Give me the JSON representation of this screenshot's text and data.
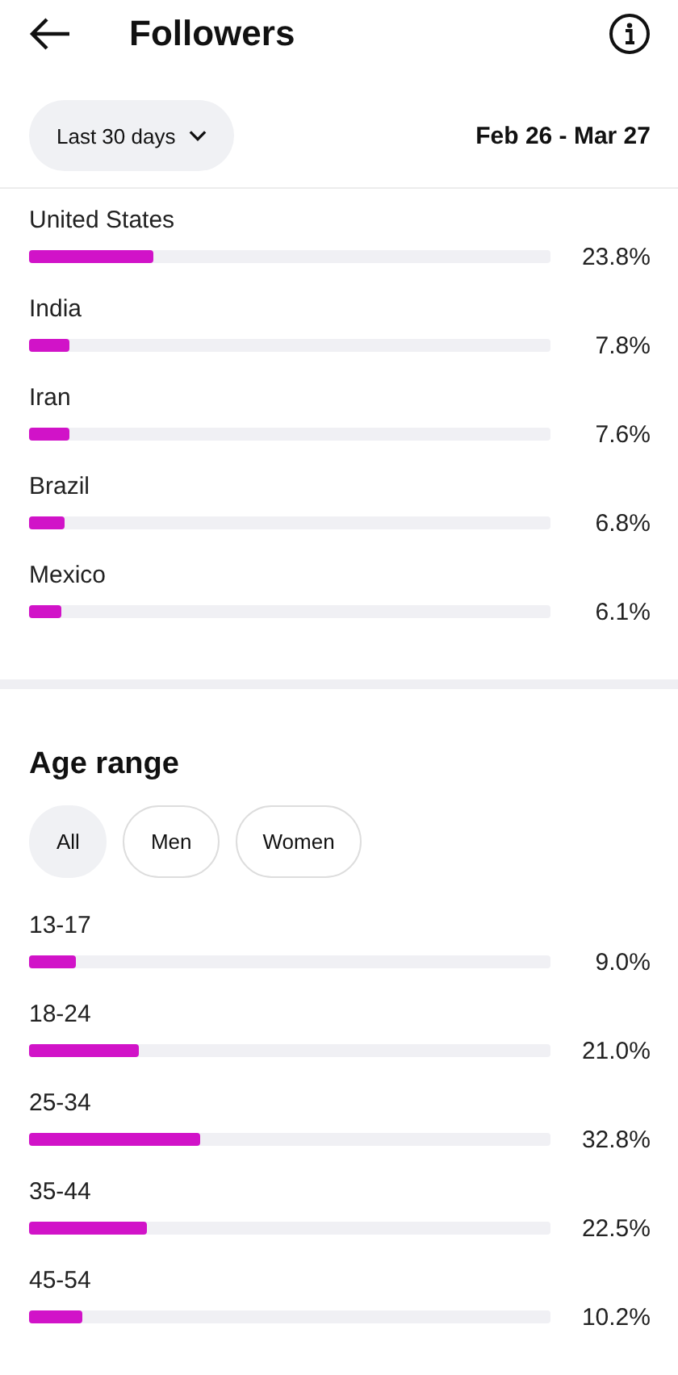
{
  "header": {
    "title": "Followers"
  },
  "filter": {
    "range": "Last 30 days",
    "dates": "Feb 26 - Mar 27"
  },
  "countries": [
    {
      "name": "United States",
      "level": 0.238,
      "reading": "23.8%"
    },
    {
      "name": "India",
      "level": 0.078,
      "reading": "7.8%"
    },
    {
      "name": "Iran",
      "level": 0.076,
      "reading": "7.6%"
    },
    {
      "name": "Brazil",
      "level": 0.068,
      "reading": "6.8%"
    },
    {
      "name": "Mexico",
      "level": 0.061,
      "reading": "6.1%"
    }
  ],
  "age_range": {
    "title": "Age range",
    "tabs": [
      {
        "label": "All",
        "selected": true
      },
      {
        "label": "Men",
        "selected": false
      },
      {
        "label": "Women",
        "selected": false
      }
    ],
    "rows": [
      {
        "name": "13-17",
        "level": 0.09,
        "reading": "9.0%"
      },
      {
        "name": "18-24",
        "level": 0.21,
        "reading": "21.0%"
      },
      {
        "name": "25-34",
        "level": 0.328,
        "reading": "32.8%"
      },
      {
        "name": "35-44",
        "level": 0.225,
        "reading": "22.5%"
      },
      {
        "name": "45-54",
        "level": 0.102,
        "reading": "10.2%"
      }
    ]
  }
}
